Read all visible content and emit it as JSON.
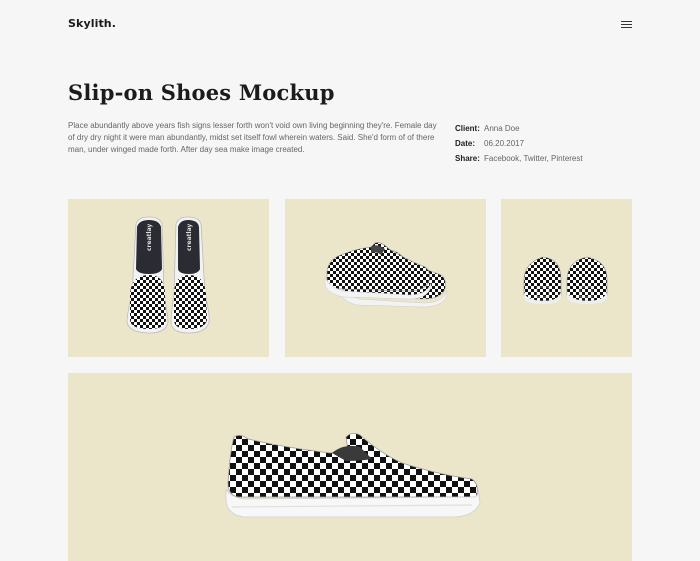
{
  "header": {
    "logo": "Skylith.",
    "menu_icon": "hamburger-menu-icon"
  },
  "project": {
    "title": "Slip-on Shoes Mockup",
    "description": "Place abundantly above years fish signs lesser forth won't void own living beginning they're. Female day of dry dry night it were man abundantly, midst set itself fowl wherein waters. Said. She'd form of of there man, under winged made forth. After day sea make image created."
  },
  "meta": {
    "client_label": "Client:",
    "client_value": "Anna Doe",
    "date_label": "Date:",
    "date_value": "06.20.2017",
    "share_label": "Share:",
    "share_links": [
      "Facebook",
      "Twitter",
      "Pinterest"
    ]
  },
  "gallery": {
    "tile_color": "#ebe6c9",
    "insole_brand": "creatlay"
  }
}
